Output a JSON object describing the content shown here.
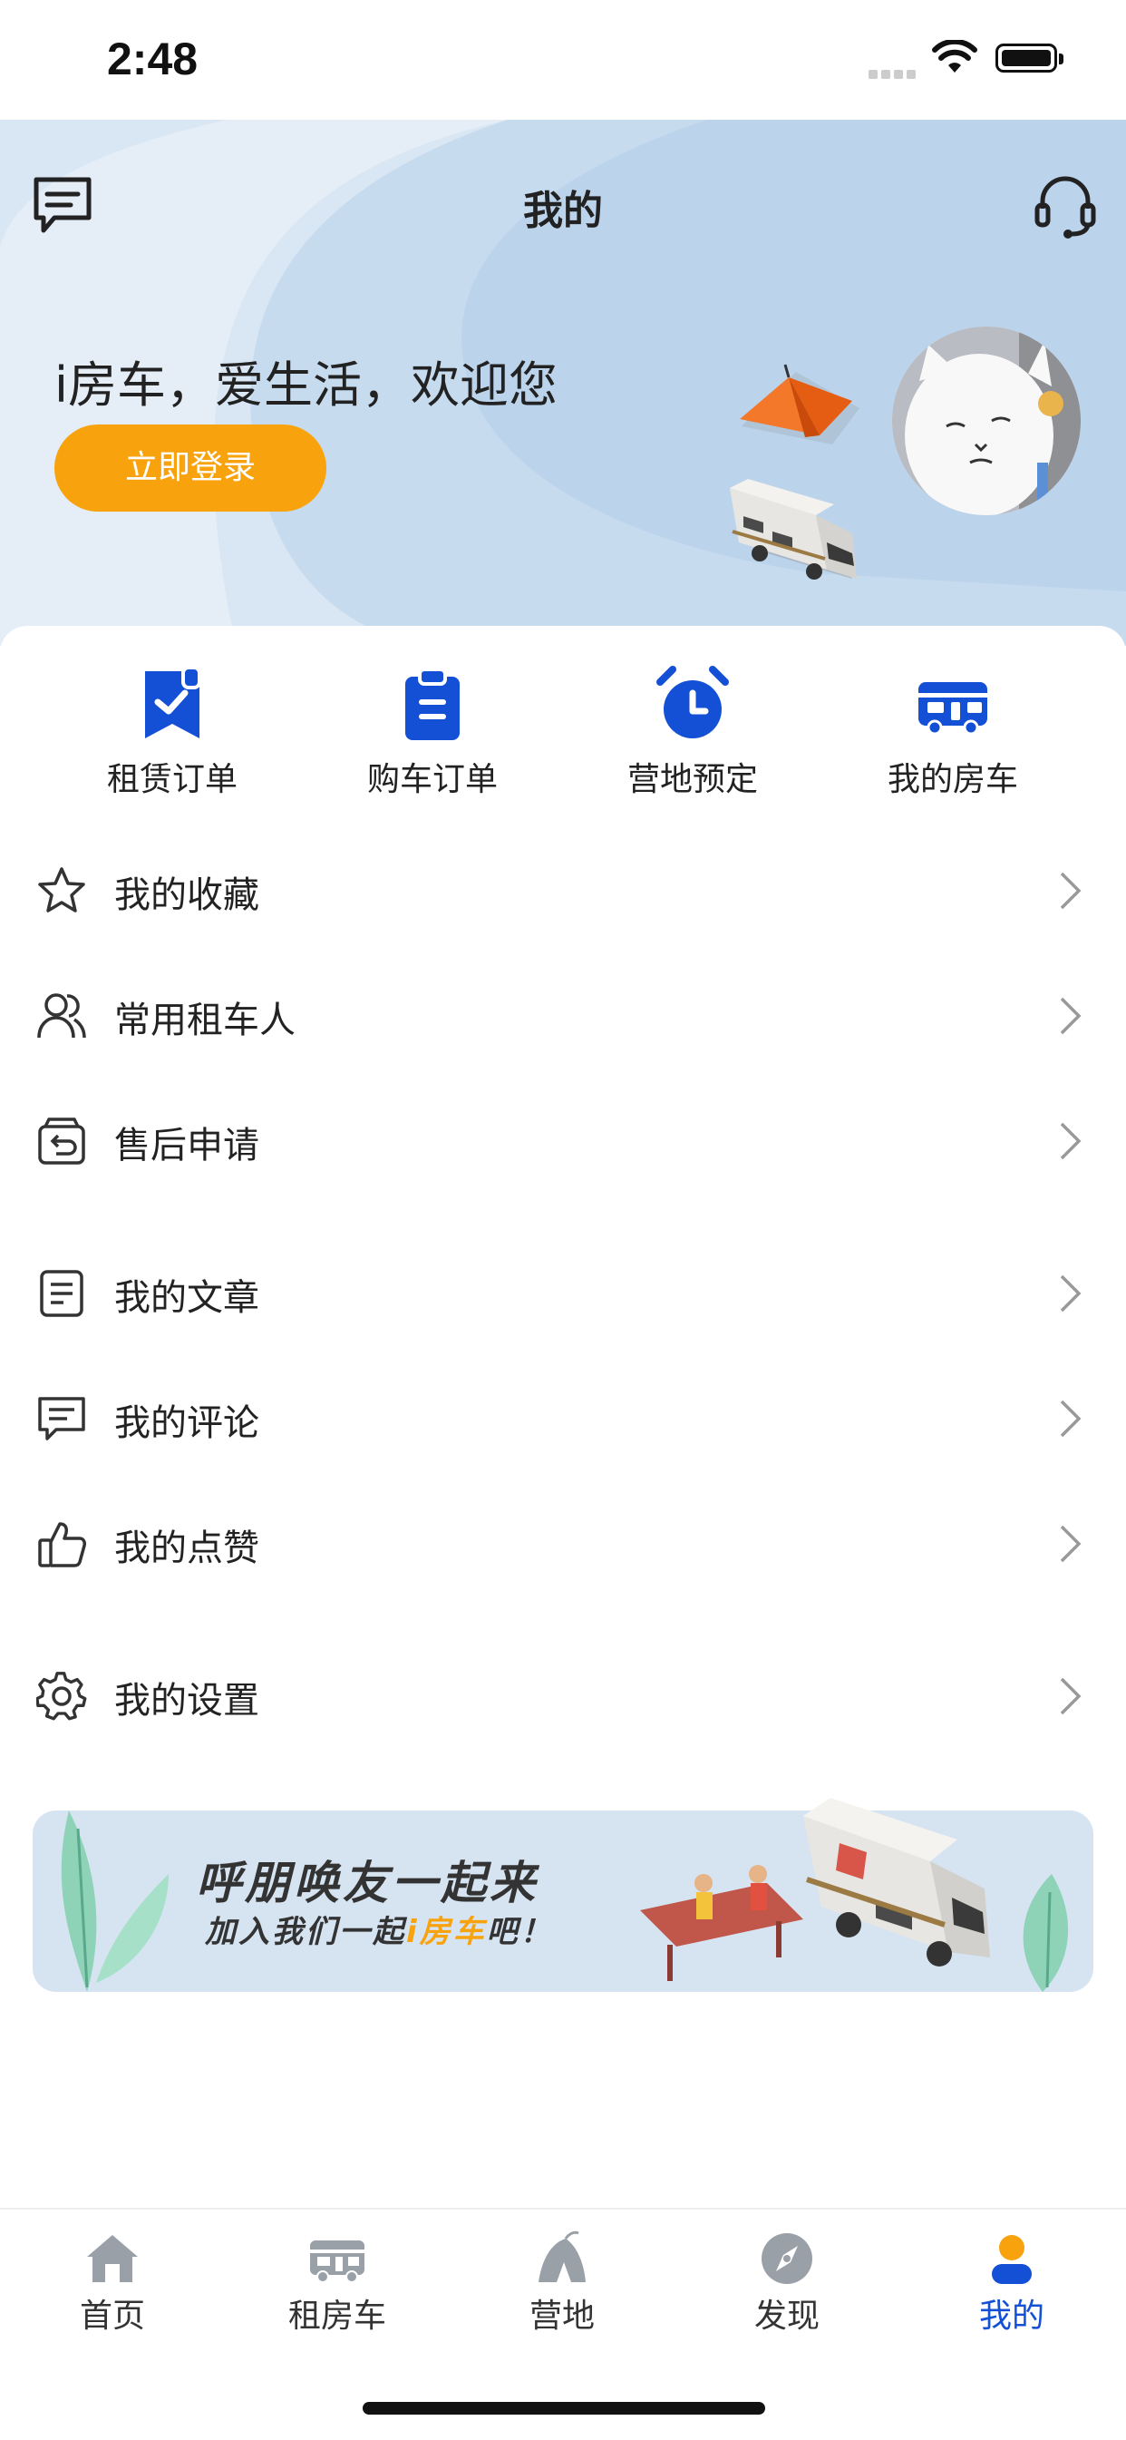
{
  "status_bar": {
    "time": "2:48"
  },
  "header": {
    "title": "我的",
    "welcome": "i房车，爱生活，欢迎您",
    "login_button": "立即登录"
  },
  "quick_actions": [
    {
      "label": "租赁订单",
      "icon": "rental-order-icon"
    },
    {
      "label": "购车订单",
      "icon": "purchase-order-icon"
    },
    {
      "label": "营地预定",
      "icon": "alarm-clock-icon"
    },
    {
      "label": "我的房车",
      "icon": "rv-icon"
    }
  ],
  "menu": [
    {
      "label": "我的收藏",
      "icon": "star-icon"
    },
    {
      "label": "常用租车人",
      "icon": "users-icon"
    },
    {
      "label": "售后申请",
      "icon": "return-box-icon"
    },
    {
      "label": "我的文章",
      "icon": "document-icon"
    },
    {
      "label": "我的评论",
      "icon": "comment-icon"
    },
    {
      "label": "我的点赞",
      "icon": "thumbs-up-icon"
    },
    {
      "label": "我的设置",
      "icon": "gear-icon"
    }
  ],
  "banner": {
    "title": "呼朋唤友一起来",
    "subtitle_prefix": "加入我们一起",
    "subtitle_highlight": "i房车",
    "subtitle_suffix": "吧！"
  },
  "tabbar": [
    {
      "label": "首页",
      "icon": "home-icon",
      "active": false
    },
    {
      "label": "租房车",
      "icon": "rv-tab-icon",
      "active": false
    },
    {
      "label": "营地",
      "icon": "camp-icon",
      "active": false
    },
    {
      "label": "发现",
      "icon": "compass-icon",
      "active": false
    },
    {
      "label": "我的",
      "icon": "profile-icon",
      "active": true
    }
  ],
  "colors": {
    "accent": "#1450d6",
    "login": "#f8a30e",
    "header_bg": "#cfdff0"
  }
}
